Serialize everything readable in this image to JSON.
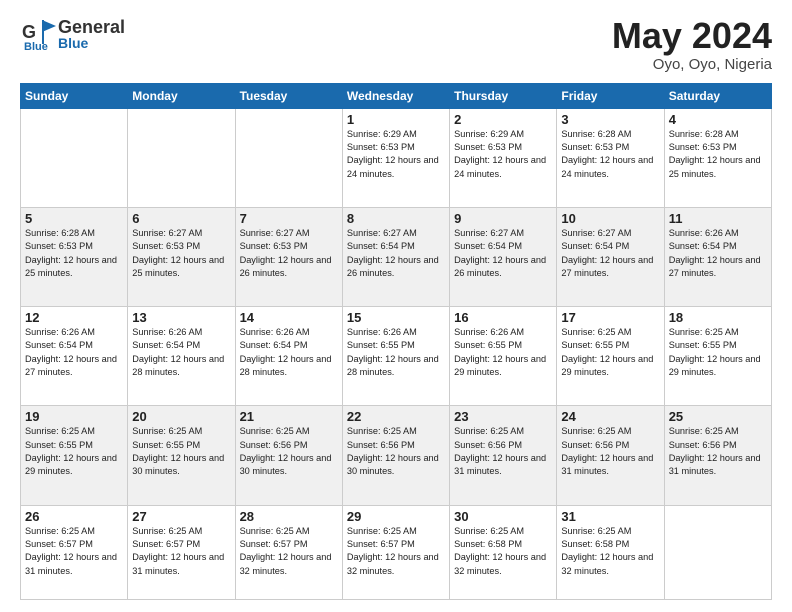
{
  "header": {
    "logo_general": "General",
    "logo_blue": "Blue",
    "month_year": "May 2024",
    "location": "Oyo, Oyo, Nigeria"
  },
  "weekdays": [
    "Sunday",
    "Monday",
    "Tuesday",
    "Wednesday",
    "Thursday",
    "Friday",
    "Saturday"
  ],
  "weeks": [
    [
      {
        "day": "",
        "sunrise": "",
        "sunset": "",
        "daylight": ""
      },
      {
        "day": "",
        "sunrise": "",
        "sunset": "",
        "daylight": ""
      },
      {
        "day": "",
        "sunrise": "",
        "sunset": "",
        "daylight": ""
      },
      {
        "day": "1",
        "sunrise": "Sunrise: 6:29 AM",
        "sunset": "Sunset: 6:53 PM",
        "daylight": "Daylight: 12 hours and 24 minutes."
      },
      {
        "day": "2",
        "sunrise": "Sunrise: 6:29 AM",
        "sunset": "Sunset: 6:53 PM",
        "daylight": "Daylight: 12 hours and 24 minutes."
      },
      {
        "day": "3",
        "sunrise": "Sunrise: 6:28 AM",
        "sunset": "Sunset: 6:53 PM",
        "daylight": "Daylight: 12 hours and 24 minutes."
      },
      {
        "day": "4",
        "sunrise": "Sunrise: 6:28 AM",
        "sunset": "Sunset: 6:53 PM",
        "daylight": "Daylight: 12 hours and 25 minutes."
      }
    ],
    [
      {
        "day": "5",
        "sunrise": "Sunrise: 6:28 AM",
        "sunset": "Sunset: 6:53 PM",
        "daylight": "Daylight: 12 hours and 25 minutes."
      },
      {
        "day": "6",
        "sunrise": "Sunrise: 6:27 AM",
        "sunset": "Sunset: 6:53 PM",
        "daylight": "Daylight: 12 hours and 25 minutes."
      },
      {
        "day": "7",
        "sunrise": "Sunrise: 6:27 AM",
        "sunset": "Sunset: 6:53 PM",
        "daylight": "Daylight: 12 hours and 26 minutes."
      },
      {
        "day": "8",
        "sunrise": "Sunrise: 6:27 AM",
        "sunset": "Sunset: 6:54 PM",
        "daylight": "Daylight: 12 hours and 26 minutes."
      },
      {
        "day": "9",
        "sunrise": "Sunrise: 6:27 AM",
        "sunset": "Sunset: 6:54 PM",
        "daylight": "Daylight: 12 hours and 26 minutes."
      },
      {
        "day": "10",
        "sunrise": "Sunrise: 6:27 AM",
        "sunset": "Sunset: 6:54 PM",
        "daylight": "Daylight: 12 hours and 27 minutes."
      },
      {
        "day": "11",
        "sunrise": "Sunrise: 6:26 AM",
        "sunset": "Sunset: 6:54 PM",
        "daylight": "Daylight: 12 hours and 27 minutes."
      }
    ],
    [
      {
        "day": "12",
        "sunrise": "Sunrise: 6:26 AM",
        "sunset": "Sunset: 6:54 PM",
        "daylight": "Daylight: 12 hours and 27 minutes."
      },
      {
        "day": "13",
        "sunrise": "Sunrise: 6:26 AM",
        "sunset": "Sunset: 6:54 PM",
        "daylight": "Daylight: 12 hours and 28 minutes."
      },
      {
        "day": "14",
        "sunrise": "Sunrise: 6:26 AM",
        "sunset": "Sunset: 6:54 PM",
        "daylight": "Daylight: 12 hours and 28 minutes."
      },
      {
        "day": "15",
        "sunrise": "Sunrise: 6:26 AM",
        "sunset": "Sunset: 6:55 PM",
        "daylight": "Daylight: 12 hours and 28 minutes."
      },
      {
        "day": "16",
        "sunrise": "Sunrise: 6:26 AM",
        "sunset": "Sunset: 6:55 PM",
        "daylight": "Daylight: 12 hours and 29 minutes."
      },
      {
        "day": "17",
        "sunrise": "Sunrise: 6:25 AM",
        "sunset": "Sunset: 6:55 PM",
        "daylight": "Daylight: 12 hours and 29 minutes."
      },
      {
        "day": "18",
        "sunrise": "Sunrise: 6:25 AM",
        "sunset": "Sunset: 6:55 PM",
        "daylight": "Daylight: 12 hours and 29 minutes."
      }
    ],
    [
      {
        "day": "19",
        "sunrise": "Sunrise: 6:25 AM",
        "sunset": "Sunset: 6:55 PM",
        "daylight": "Daylight: 12 hours and 29 minutes."
      },
      {
        "day": "20",
        "sunrise": "Sunrise: 6:25 AM",
        "sunset": "Sunset: 6:55 PM",
        "daylight": "Daylight: 12 hours and 30 minutes."
      },
      {
        "day": "21",
        "sunrise": "Sunrise: 6:25 AM",
        "sunset": "Sunset: 6:56 PM",
        "daylight": "Daylight: 12 hours and 30 minutes."
      },
      {
        "day": "22",
        "sunrise": "Sunrise: 6:25 AM",
        "sunset": "Sunset: 6:56 PM",
        "daylight": "Daylight: 12 hours and 30 minutes."
      },
      {
        "day": "23",
        "sunrise": "Sunrise: 6:25 AM",
        "sunset": "Sunset: 6:56 PM",
        "daylight": "Daylight: 12 hours and 31 minutes."
      },
      {
        "day": "24",
        "sunrise": "Sunrise: 6:25 AM",
        "sunset": "Sunset: 6:56 PM",
        "daylight": "Daylight: 12 hours and 31 minutes."
      },
      {
        "day": "25",
        "sunrise": "Sunrise: 6:25 AM",
        "sunset": "Sunset: 6:56 PM",
        "daylight": "Daylight: 12 hours and 31 minutes."
      }
    ],
    [
      {
        "day": "26",
        "sunrise": "Sunrise: 6:25 AM",
        "sunset": "Sunset: 6:57 PM",
        "daylight": "Daylight: 12 hours and 31 minutes."
      },
      {
        "day": "27",
        "sunrise": "Sunrise: 6:25 AM",
        "sunset": "Sunset: 6:57 PM",
        "daylight": "Daylight: 12 hours and 31 minutes."
      },
      {
        "day": "28",
        "sunrise": "Sunrise: 6:25 AM",
        "sunset": "Sunset: 6:57 PM",
        "daylight": "Daylight: 12 hours and 32 minutes."
      },
      {
        "day": "29",
        "sunrise": "Sunrise: 6:25 AM",
        "sunset": "Sunset: 6:57 PM",
        "daylight": "Daylight: 12 hours and 32 minutes."
      },
      {
        "day": "30",
        "sunrise": "Sunrise: 6:25 AM",
        "sunset": "Sunset: 6:58 PM",
        "daylight": "Daylight: 12 hours and 32 minutes."
      },
      {
        "day": "31",
        "sunrise": "Sunrise: 6:25 AM",
        "sunset": "Sunset: 6:58 PM",
        "daylight": "Daylight: 12 hours and 32 minutes."
      },
      {
        "day": "",
        "sunrise": "",
        "sunset": "",
        "daylight": ""
      }
    ]
  ]
}
